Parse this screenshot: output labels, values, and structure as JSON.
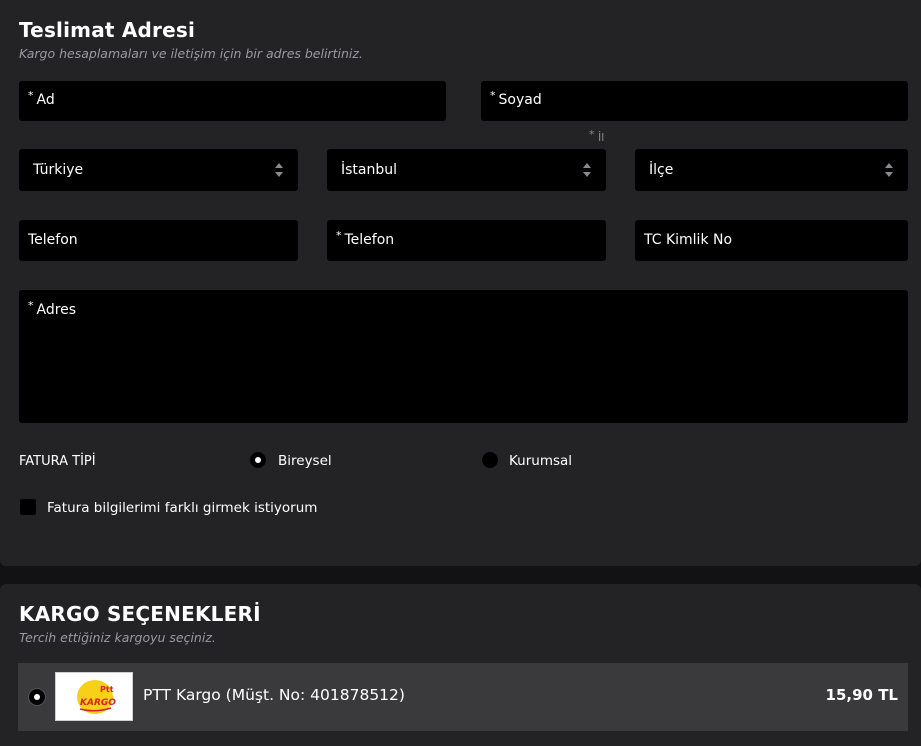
{
  "address": {
    "title": "Teslimat Adresi",
    "subtitle": "Kargo hesaplamaları ve iletişim için bir adres belirtiniz.",
    "required_mark": "*",
    "first_name": {
      "placeholder": "Ad",
      "required": true
    },
    "last_name": {
      "placeholder": "Soyad",
      "required": true
    },
    "city_label": "İl",
    "country": {
      "value": "Türkiye"
    },
    "city": {
      "value": "İstanbul"
    },
    "district": {
      "value": "İlçe"
    },
    "phone_1": {
      "placeholder": "Telefon",
      "required": false
    },
    "phone_2": {
      "placeholder": "Telefon",
      "required": true
    },
    "tc_no": {
      "placeholder": "TC Kimlik No",
      "required": false
    },
    "address_text": {
      "placeholder": "Adres",
      "required": true
    },
    "invoice_type_label": "FATURA TİPİ",
    "invoice_options": [
      {
        "label": "Bireysel",
        "selected": true
      },
      {
        "label": "Kurumsal",
        "selected": false
      }
    ],
    "different_billing": {
      "label": "Fatura bilgilerimi farklı girmek istiyorum",
      "checked": false
    }
  },
  "cargo": {
    "title": "KARGO SEÇENEKLERİ",
    "subtitle": "Tercih ettiğiniz kargoyu seçiniz.",
    "options": [
      {
        "name": "PTT Kargo (Müşt. No: 401878512)",
        "price": "15,90 TL",
        "selected": true,
        "logo_text_top": "Ptt",
        "logo_text_bottom": "KARGO"
      }
    ]
  },
  "colors": {
    "background": "#121214",
    "panel": "#232326",
    "field": "#000000",
    "cargo_row": "#3a3a3d",
    "logo_yellow": "#f7d117",
    "logo_red": "#d2232a"
  }
}
